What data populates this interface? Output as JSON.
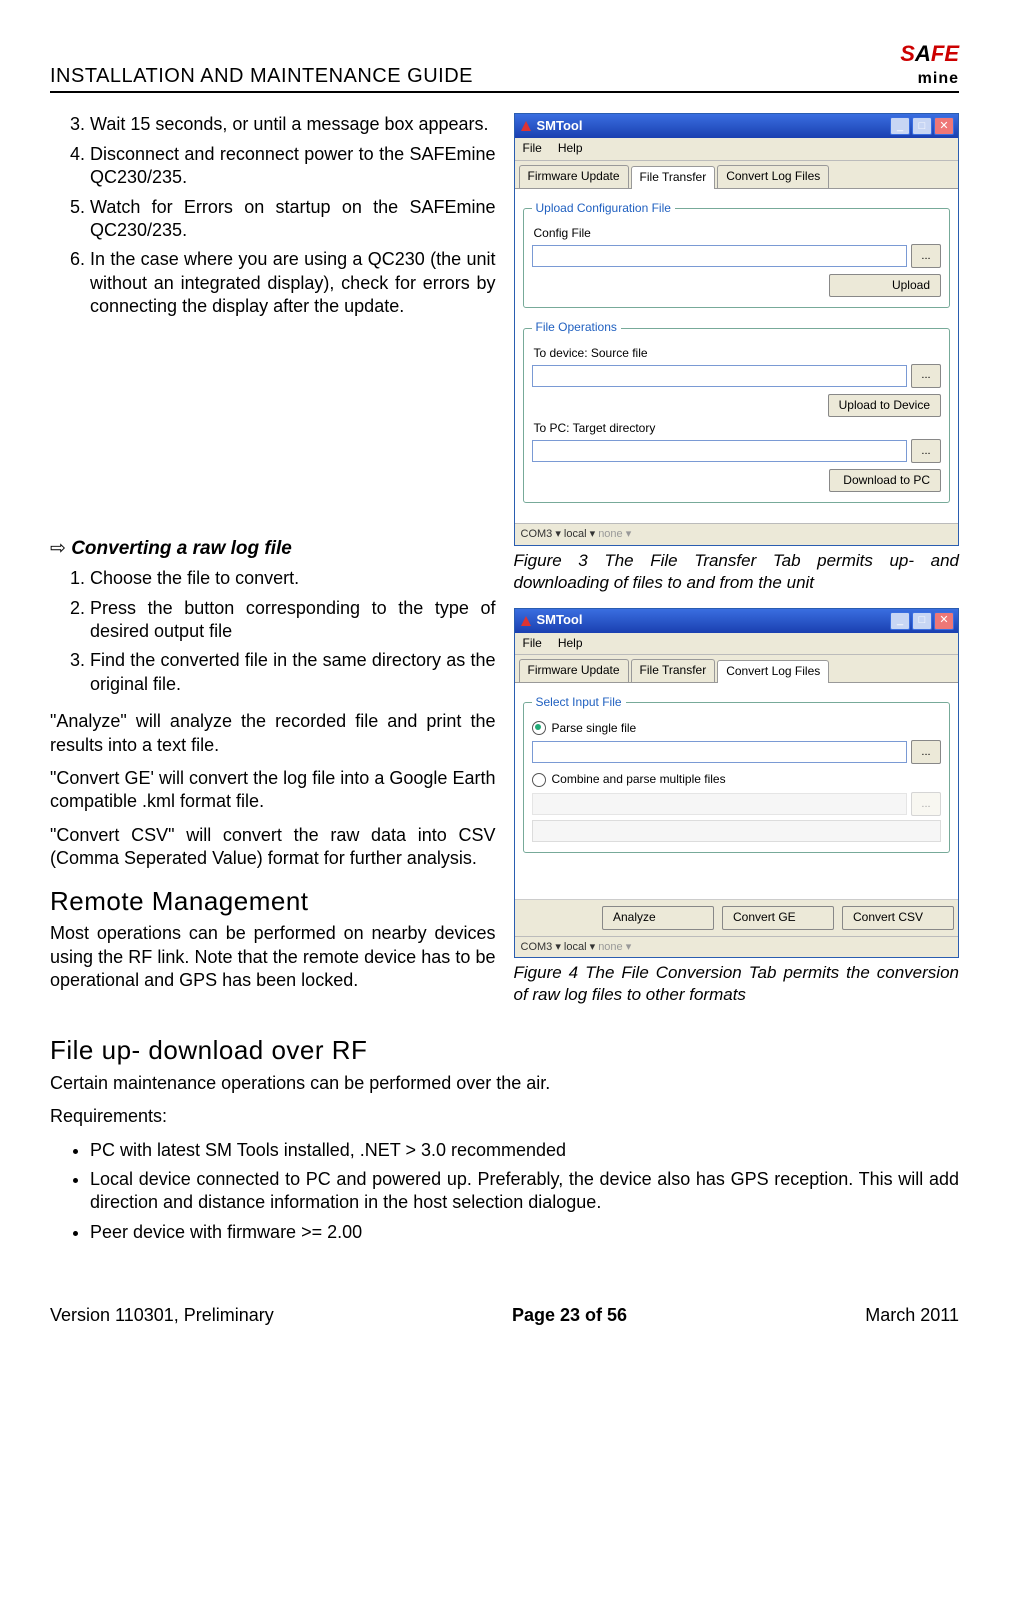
{
  "header": {
    "title": "INSTALLATION AND MAINTENANCE GUIDE",
    "logo_safe": "SAFE",
    "logo_mine": "mine"
  },
  "left": {
    "list1": {
      "start": 3,
      "items": [
        "Wait 15 seconds, or until a message box appears.",
        "Disconnect and reconnect power to the SAFEmine QC230/235.",
        "Watch for Errors on startup on the SAFEmine QC230/235.",
        "In the case where you are using a QC230 (the unit without an integrated display), check for errors by connecting the display after the update."
      ]
    },
    "section2_heading": "Converting a raw log file",
    "list2": [
      "Choose the file to convert.",
      "Press the button corresponding to the type of desired output file",
      "Find the converted file in the same directory as the original file."
    ],
    "p_analyze": "\"Analyze\" will analyze the recorded file and print the results into a text file.",
    "p_convertge": "\"Convert GE' will convert the log file into a Google Earth compatible .kml format file.",
    "p_convertcsv": "\"Convert CSV\" will convert the raw data into CSV (Comma Seperated Value) format for further analysis.",
    "h_remote": "Remote Management",
    "p_remote": "Most operations can be performed on nearby devices using the RF link. Note that the remote device has to be operational and GPS has been locked."
  },
  "full": {
    "h_rf": "File up- download over RF",
    "p_rf": "Certain maintenance operations can be performed over the air.",
    "req_label": "Requirements:",
    "req_items": [
      "PC with latest SM Tools installed, .NET > 3.0 recommended",
      "Local device connected to PC and powered up. Preferably, the device also has GPS reception. This will add direction and distance information in the host selection dialogue.",
      "Peer device with firmware >= 2.00"
    ]
  },
  "win1": {
    "title": "SMTool",
    "menu_file": "File",
    "menu_help": "Help",
    "tab1": "Firmware Update",
    "tab2": "File Transfer",
    "tab3": "Convert Log Files",
    "group1_legend": "Upload Configuration File",
    "lbl_config": "Config File",
    "btn_dots": "...",
    "btn_upload": "Upload",
    "group2_legend": "File Operations",
    "lbl_todevice": "To device: Source file",
    "btn_upload_device": "Upload to Device",
    "lbl_topc": "To PC: Target directory",
    "btn_download": "Download to PC",
    "status_com": "COM3 ▾",
    "status_local": "local ▾",
    "status_none": "none ▾",
    "caption": "Figure 3 The File Transfer Tab permits up- and downloading of files to and from the unit"
  },
  "win2": {
    "title": "SMTool",
    "menu_file": "File",
    "menu_help": "Help",
    "tab1": "Firmware Update",
    "tab2": "File Transfer",
    "tab3": "Convert Log Files",
    "group_legend": "Select Input File",
    "radio1": "Parse single file",
    "radio2": "Combine and parse multiple files",
    "btn_dots": "...",
    "btn_analyze": "Analyze",
    "btn_ge": "Convert GE",
    "btn_csv": "Convert CSV",
    "status_com": "COM3 ▾",
    "status_local": "local ▾",
    "status_none": "none ▾",
    "caption": "Figure 4 The File Conversion Tab permits the conversion of raw log files to other formats"
  },
  "footer": {
    "left": "Version 110301, Preliminary",
    "center": "Page 23 of 56",
    "right": "March 2011"
  }
}
